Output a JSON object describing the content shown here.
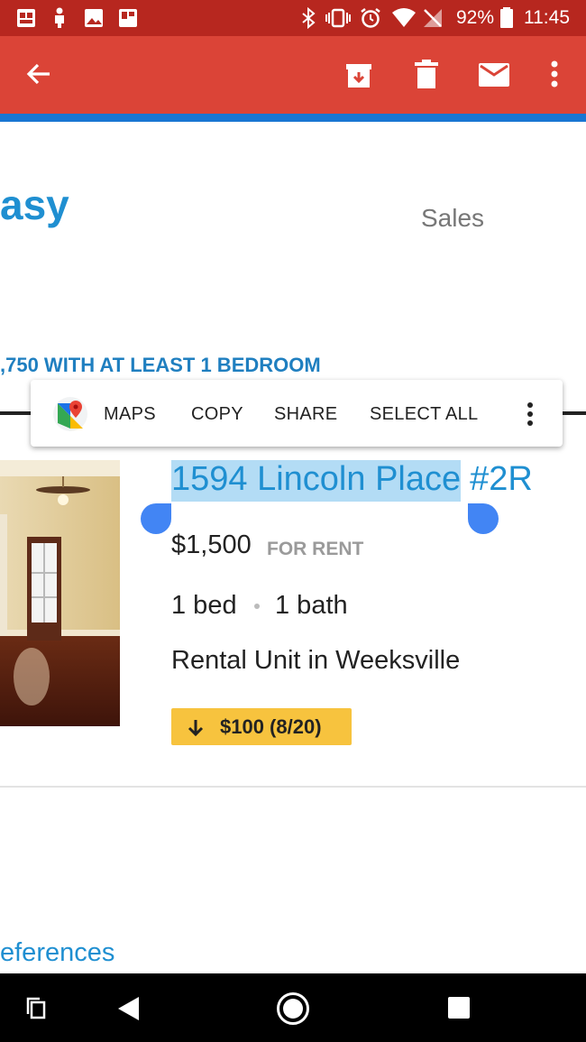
{
  "status_bar": {
    "battery": "92%",
    "time": "11:45"
  },
  "app_bar": {
    "icons": [
      "back-arrow-icon",
      "archive-icon",
      "delete-icon",
      "mail-icon",
      "more-vert-icon"
    ]
  },
  "email": {
    "logo_partial": "asy",
    "sales_link": "Sales",
    "heading": ",750 WITH AT LEAST 1 BEDROOM",
    "listing": {
      "address_selected": "1594 Lincoln Place",
      "unit": "#2R",
      "price": "$1,500",
      "price_label": "FOR RENT",
      "beds": "1 bed",
      "baths": "1 bath",
      "description": "Rental Unit in Weeksville",
      "price_drop": "$100 (8/20)"
    },
    "preferences_partial": "eferences"
  },
  "selection_toolbar": {
    "maps": "MAPS",
    "copy": "COPY",
    "share": "SHARE",
    "select_all": "SELECT ALL"
  },
  "colors": {
    "status_bar": "#b7271f",
    "app_bar": "#db4437",
    "accent_blue": "#1f8fd1",
    "selection": "#b3dcf5",
    "handle": "#4285f4",
    "badge": "#f7c33e"
  }
}
